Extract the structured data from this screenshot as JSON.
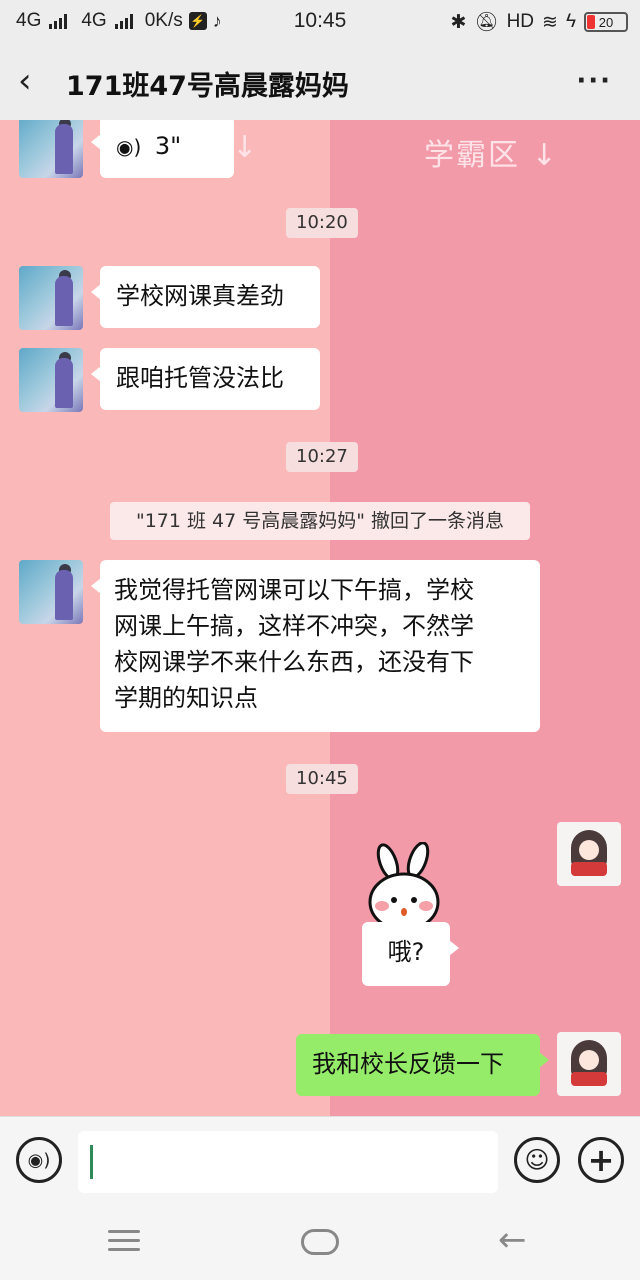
{
  "status_bar": {
    "network1": "4G",
    "network2": "4G",
    "speed": "0K/s",
    "time": "10:45",
    "hd": "HD",
    "battery": "20"
  },
  "header": {
    "back_icon": "chevron-left-icon",
    "title": "171班47号高晨露妈妈",
    "more_icon": "more-dots-icon"
  },
  "background": {
    "zone_label": "学霸区",
    "arrow": "↓"
  },
  "messages": {
    "voice_duration": "3\"",
    "time1": "10:20",
    "msg1": "学校网课真差劲",
    "msg2": "跟咱托管没法比",
    "time2": "10:27",
    "recall_notice": "\"171 班 47 号高晨露妈妈\" 撤回了一条消息",
    "msg3_line1": "我觉得托管网课可以下午搞，学校",
    "msg3_line2": "网课上午搞，这样不冲突，不然学",
    "msg3_line3": "校网课学不来什么东西，还没有下",
    "msg3_line4": "学期的知识点",
    "time3": "10:45",
    "reply1": "哦?",
    "reply2": "我和校长反馈一下"
  },
  "input_bar": {
    "voice_icon": "voice-wave-icon",
    "emoji_icon": "smiley-icon",
    "plus_icon": "plus-icon",
    "input_value": ""
  },
  "colors": {
    "chat_bg_left": "#fbb8b8",
    "chat_bg_right": "#f39aa8",
    "self_bubble": "#95ec69"
  }
}
